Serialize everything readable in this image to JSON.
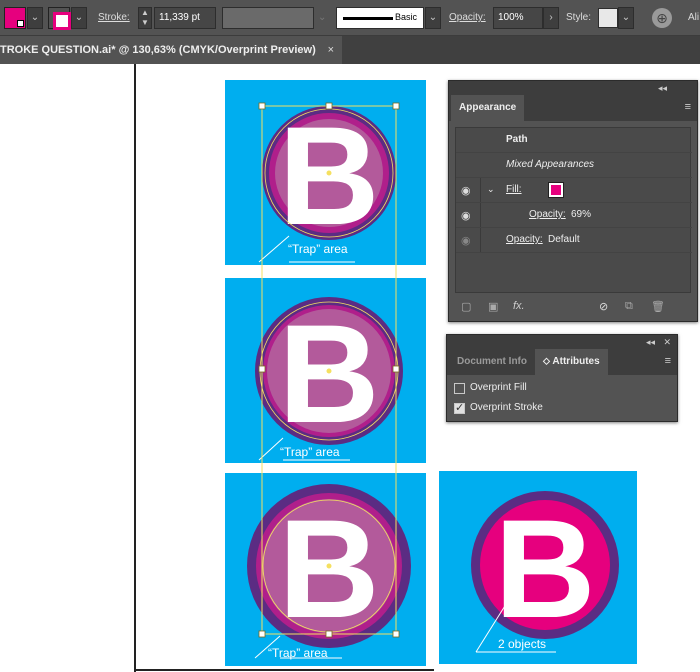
{
  "control_bar": {
    "stroke_label": "Stroke:",
    "stroke_value": "11,339 pt",
    "brush_label": "Basic",
    "opacity_label": "Opacity:",
    "opacity_value": "100%",
    "style_label": "Style:",
    "align_label": "Ali",
    "icons": [
      "fill-swatch",
      "stroke-swatch",
      "chevron-down-icon",
      "stepper-icon",
      "globe-icon"
    ]
  },
  "document_tab": {
    "title": "TROKE QUESTION.ai* @ 130,63% (CMYK/Overprint Preview)",
    "close": "×"
  },
  "artwork": {
    "letter": "B",
    "trap_label": "“Trap” area",
    "objects_label": "2 objects",
    "colors": {
      "cyan": "#00aeef",
      "magenta": "#e6007e",
      "purple": "#5b2c83",
      "overprint_mix": "#b35a9b"
    }
  },
  "appearance_panel": {
    "tab": "Appearance",
    "path_label": "Path",
    "mixed_label": "Mixed Appearances",
    "fill_label": "Fill:",
    "fill_opacity_label": "Opacity:",
    "fill_opacity_value": "69%",
    "opacity_label": "Opacity:",
    "opacity_value": "Default",
    "fx_label": "fx."
  },
  "attributes_panel": {
    "tab_inactive": "Document Info",
    "tab_active": "Attributes",
    "overprint_fill_label": "Overprint Fill",
    "overprint_fill_checked": false,
    "overprint_stroke_label": "Overprint Stroke",
    "overprint_stroke_checked": true
  }
}
